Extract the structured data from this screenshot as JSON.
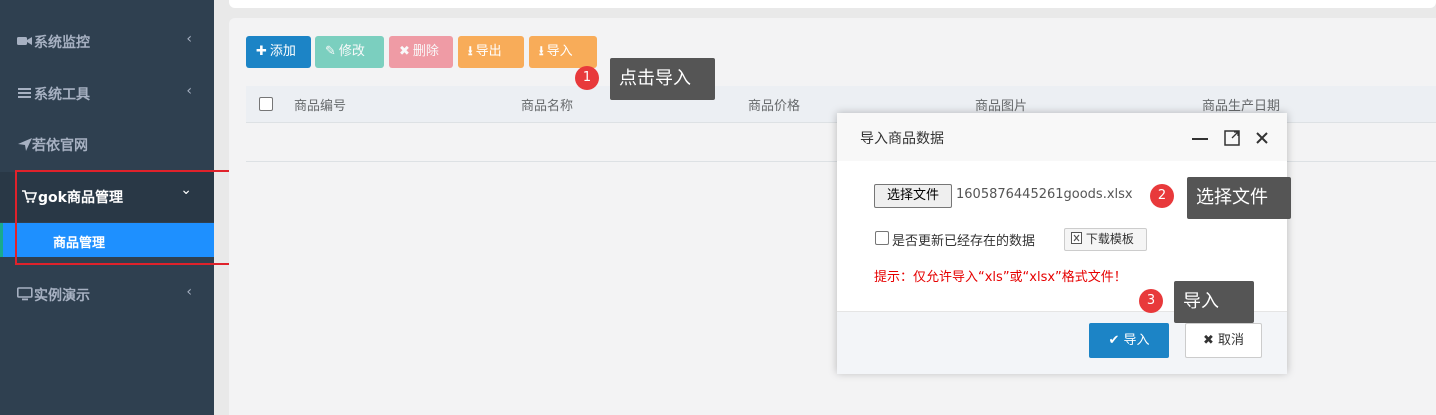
{
  "sidebar": {
    "items": [
      {
        "icon": "video-camera-icon",
        "label": "系统监控",
        "arrow": "‹"
      },
      {
        "icon": "menu-bars-icon",
        "label": "系统工具",
        "arrow": "‹"
      },
      {
        "icon": "paper-plane-icon",
        "label": "若依官网"
      },
      {
        "icon": "cart-icon",
        "label": "gok商品管理",
        "arrow": "⌄",
        "expanded": true
      },
      {
        "icon": "monitor-icon",
        "label": "实例演示",
        "arrow": "‹"
      }
    ],
    "subitem": {
      "label": "商品管理"
    }
  },
  "toolbar": {
    "add": "添加",
    "edit": "修改",
    "delete": "删除",
    "export": "导出",
    "import": "导入"
  },
  "table": {
    "columns": [
      "商品编号",
      "商品名称",
      "商品价格",
      "商品图片",
      "商品生产日期"
    ]
  },
  "callouts": [
    {
      "num": "1",
      "text": "点击导入"
    },
    {
      "num": "2",
      "text": "选择文件"
    },
    {
      "num": "3",
      "text": "导入"
    }
  ],
  "modal": {
    "title": "导入商品数据",
    "file_button": "选择文件",
    "file_name": "1605876445261goods.xlsx",
    "checkbox_label": "是否更新已经存在的数据",
    "download_template": "下载模板",
    "hint": "提示：仅允许导入“xls”或“xlsx”格式文件！",
    "ok": "导入",
    "cancel": "取消"
  },
  "colors": {
    "sidebar_bg": "#2f4050",
    "active_sub": "#1e90ff",
    "primary": "#1c84c6",
    "badge": "#e8393b",
    "tip_bg": "#555555",
    "highlight_box": "#e0222b",
    "hint_text": "#e60000"
  }
}
